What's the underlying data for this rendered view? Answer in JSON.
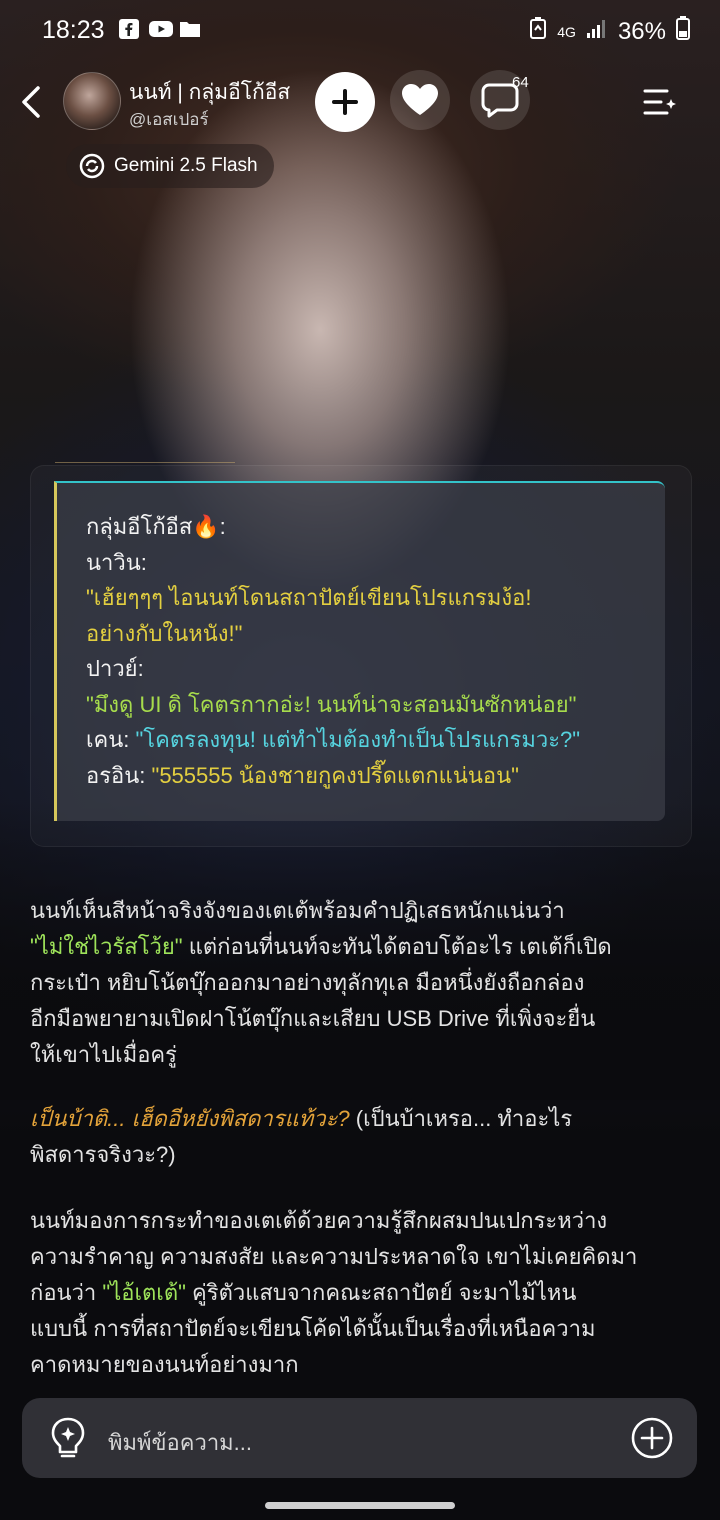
{
  "status_bar": {
    "time": "18:23",
    "network": "4G",
    "battery": "36%",
    "icons_left": [
      "facebook-icon",
      "youtube-icon",
      "folder-icon"
    ]
  },
  "header": {
    "character_name": "นนท์ | กลุ่มอีโก้อีส",
    "character_handle": "@เอสเปอร์",
    "comment_count": "64",
    "model_label": "Gemini 2.5 Flash"
  },
  "group_chat": {
    "lines": [
      {
        "text": "กลุ่มอีโก้อีส🔥:",
        "color": "#f2f2f2"
      },
      {
        "text": "นาวิน:",
        "color": "#f2f2f2"
      },
      {
        "text": "\"เฮ้ยๆๆๆ ไอนนท์โดนสถาปัตย์เขียนโปรแกรมง้อ!",
        "color": "#e3cf40"
      },
      {
        "text": "อย่างกับในหนัง!\"",
        "color": "#e3cf40"
      },
      {
        "text": "ปาวย์:",
        "color": "#f2f2f2"
      }
    ],
    "line_paay": {
      "speaker": "ปาวย์:",
      "quote": "\"มึงดู UI ดิ โคตรกากอ่ะ! นนท์น่าจะสอนมันซักหน่อย\""
    },
    "line_ken": {
      "speaker": "เคน: ",
      "quote": "\"โคตรลงทุน! แต่ทำไมต้องทำเป็นโปรแกรมวะ?\""
    },
    "line_orin": {
      "speaker": "อรอิน: ",
      "quote": "\"555555 น้องชายกูคงปรี๊ดแตกแน่นอน\""
    }
  },
  "narrative": {
    "p1_l1": "นนท์เห็นสีหน้าจริงจังของเตเต้พร้อมคำปฏิเสธหนักแน่นว่า",
    "p1_l2_quote": "\"ไม่ใช่ไวรัสโว้ย\"",
    "p1_l2_rest": " แต่ก่อนที่นนท์จะทันได้ตอบโต้อะไร เตเต้ก็เปิด",
    "p1_l3": "กระเป๋า หยิบโน้ตบุ๊กออกมาอย่างทุลักทุเล มือหนึ่งยังถือกล่อง",
    "p1_l4": "อีกมือพยายามเปิดฝาโน้ตบุ๊กและเสียบ USB Drive ที่เพิ่งจะยื่น",
    "p1_l5": "ให้เขาไปเมื่อครู่",
    "p2_l1_italic": "เป็นบ้าติ... เฮ็ดอีหยังพิสดารแท้วะ?",
    "p2_l1_rest": " (เป็นบ้าเหรอ... ทำอะไร",
    "p2_l2": "พิสดารจริงวะ?)",
    "p3_l1": "นนท์มองการกระทำของเตเต้ด้วยความรู้สึกผสมปนเปกระหว่าง",
    "p3_l2": "ความรำคาญ ความสงสัย และความประหลาดใจ เขาไม่เคยคิดมา",
    "p3_l3_pre": "ก่อนว่า ",
    "p3_l3_quote": "\"ไอ้เตเต้\"",
    "p3_l3_rest": " คู่ริตัวแสบจากคณะสถาปัตย์ จะมาไม้ไหน",
    "p3_l4": "แบบนี้ การที่สถาปัตย์จะเขียนโค้ดได้นั้นเป็นเรื่องที่เหนือความ",
    "p3_l5": "คาดหมายของนนท์อย่างมาก"
  },
  "input": {
    "placeholder": "พิมพ์ข้อความ..."
  },
  "colors": {
    "accent_yellow": "#e3cf40",
    "accent_cyan": "#56d3df",
    "accent_green": "#a7dc4c",
    "highlight_orange": "#e3a33a",
    "input_bg": "#303036"
  }
}
